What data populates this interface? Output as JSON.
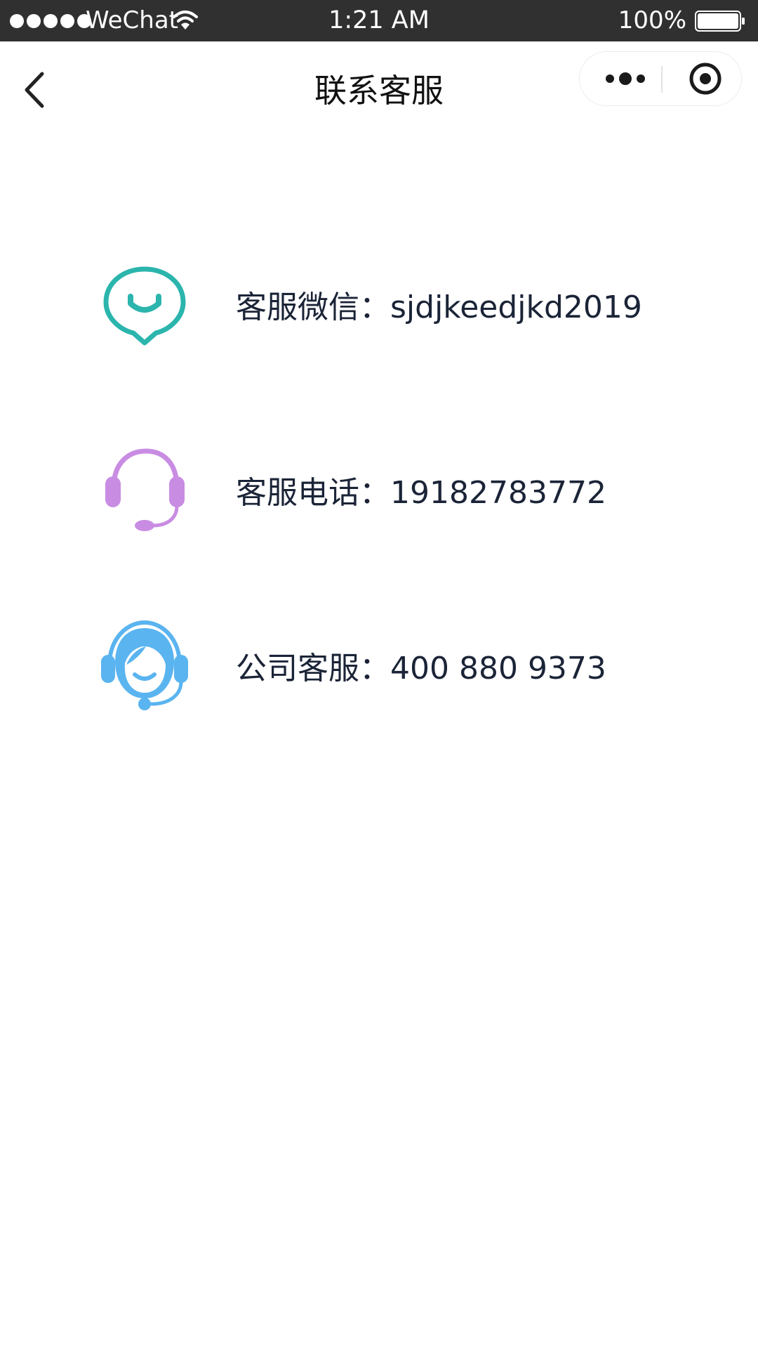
{
  "status_bar": {
    "carrier": "WeChat",
    "time": "1:21 AM",
    "battery": "100%"
  },
  "nav": {
    "title": "联系客服"
  },
  "contacts": [
    {
      "label": "客服微信：",
      "value": "sjdjkeedjkd2019",
      "icon": "wechat-smile-icon",
      "color": "#2bb5ad"
    },
    {
      "label": "客服电话：",
      "value": "19182783772",
      "icon": "headset-icon",
      "color": "#c98ce3"
    },
    {
      "label": "公司客服：",
      "value": "400 880 9373",
      "icon": "customer-service-agent-icon",
      "color": "#5ab4f0"
    }
  ]
}
